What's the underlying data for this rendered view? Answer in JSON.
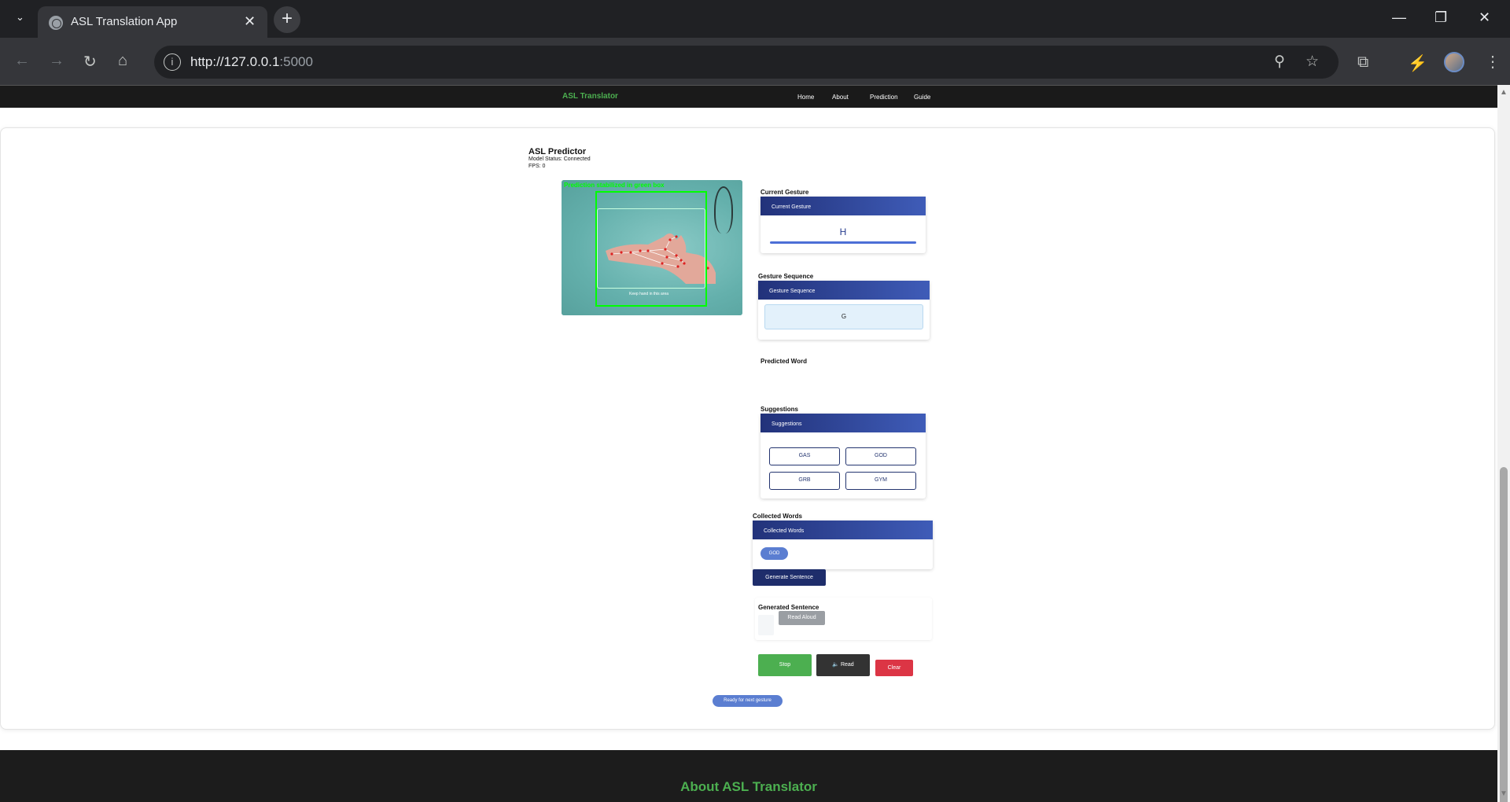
{
  "browser": {
    "tab_title": "ASL Translation App",
    "tab_close": "✕",
    "new_tab": "+",
    "url_main": "http://127.0.0.1",
    "url_port": ":5000",
    "win_minimize": "—",
    "win_restore": "❐",
    "win_close": "✕"
  },
  "site": {
    "brand": "ASL Translator",
    "menu": [
      "Home",
      "About",
      "Prediction",
      "Guide"
    ]
  },
  "predictor": {
    "title": "ASL Predictor",
    "model_status": "Model Status: Connected",
    "fps": "FPS: 0",
    "video_overlay": "Prediction stabilized in green box",
    "video_hint": "Keep hand in this area"
  },
  "current_gesture": {
    "section_label": "Current Gesture",
    "header": "Current Gesture",
    "letter": "H",
    "confidence": 1.0
  },
  "gesture_sequence": {
    "section_label": "Gesture Sequence",
    "header": "Gesture Sequence",
    "value": "G"
  },
  "predicted_word": {
    "section_label": "Predicted Word"
  },
  "suggestions": {
    "section_label": "Suggestions",
    "header": "Suggestions",
    "items": [
      "GAS",
      "GOD",
      "GRB",
      "GYM"
    ]
  },
  "collected_words": {
    "section_label": "Collected Words",
    "header": "Collected Words",
    "words": [
      "GOD"
    ]
  },
  "actions": {
    "generate_sentence": "Generate Sentence",
    "stop": "Stop",
    "read": "🔈 Read",
    "clear": "Clear"
  },
  "generated_sentence": {
    "section_label": "Generated Sentence",
    "read_aloud": "Read Aloud"
  },
  "status": "Ready for next gesture",
  "footer": {
    "title": "About ASL Translator"
  }
}
